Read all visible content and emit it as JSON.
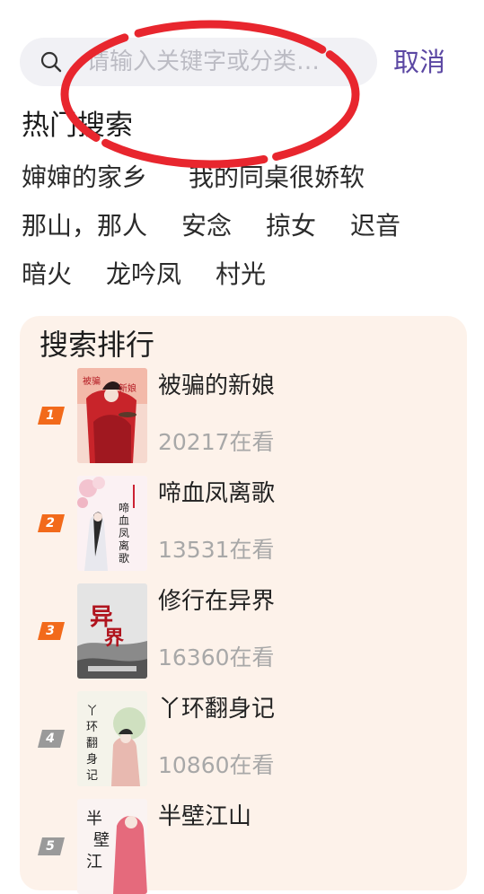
{
  "search": {
    "placeholder": "请输入关键字或分类…",
    "value": "",
    "cancel_label": "取消"
  },
  "hot": {
    "title": "热门搜索",
    "rows": [
      [
        "婶婶的家乡",
        "我的同桌很娇软"
      ],
      [
        "那山，那人",
        "安念",
        "掠女",
        "迟音"
      ],
      [
        "暗火",
        "龙吟凤",
        "村光"
      ]
    ]
  },
  "ranking": {
    "title": "搜索排行",
    "items": [
      {
        "rank": "1",
        "title": "被骗的新娘",
        "readers": "20217在看"
      },
      {
        "rank": "2",
        "title": "啼血凤离歌",
        "readers": "13531在看"
      },
      {
        "rank": "3",
        "title": "修行在异界",
        "readers": "16360在看"
      },
      {
        "rank": "4",
        "title": "丫环翻身记",
        "readers": "10860在看"
      },
      {
        "rank": "5",
        "title": "半壁江山",
        "readers": ""
      }
    ]
  },
  "colors": {
    "accent": "#5b47a3",
    "rank_top": "#f26a1b",
    "rank_other": "#9a9a9a",
    "card_bg": "#fdf2ea",
    "annotation": "#e8262e"
  }
}
